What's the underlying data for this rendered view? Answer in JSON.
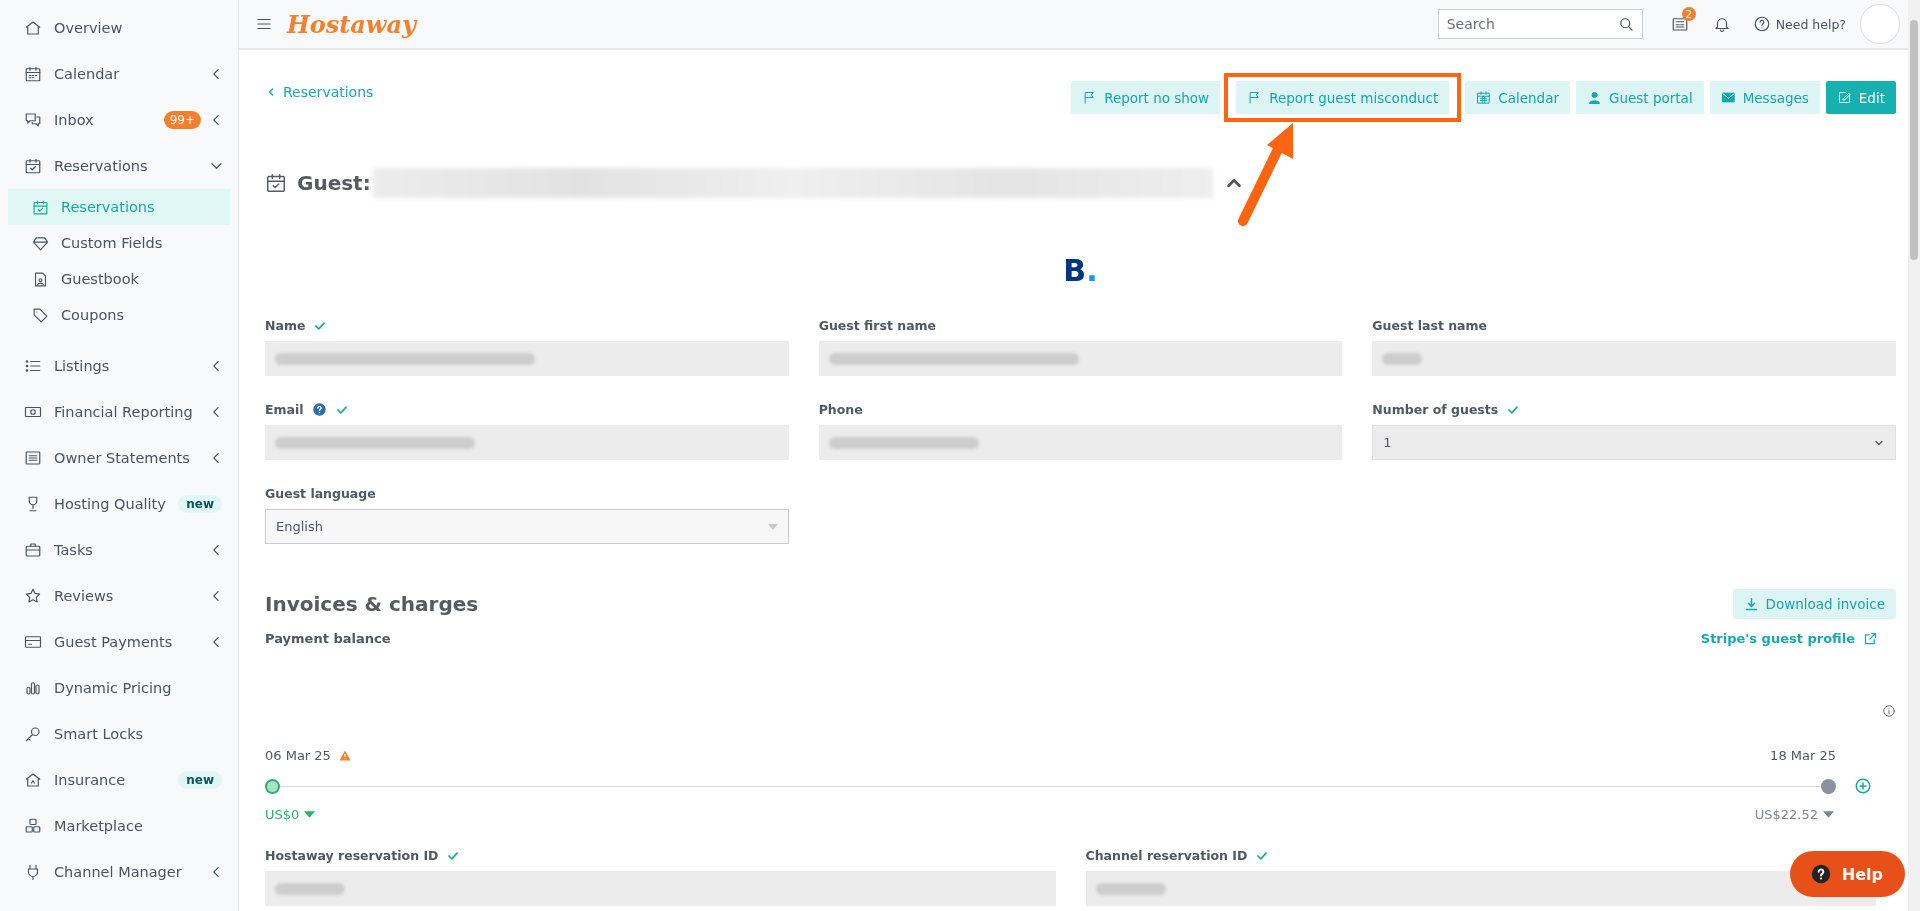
{
  "sidebar": {
    "items": [
      {
        "label": "Overview",
        "kind": "plain"
      },
      {
        "label": "Calendar",
        "kind": "collapsible",
        "expanded": false
      },
      {
        "label": "Inbox",
        "kind": "collapsible",
        "expanded": false,
        "badge": "99+"
      },
      {
        "label": "Reservations",
        "kind": "collapsible",
        "expanded": true,
        "children": [
          {
            "label": "Reservations",
            "selected": true
          },
          {
            "label": "Custom Fields",
            "selected": false
          },
          {
            "label": "Guestbook",
            "selected": false
          },
          {
            "label": "Coupons",
            "selected": false
          }
        ]
      },
      {
        "label": "Listings",
        "kind": "collapsible",
        "expanded": false
      },
      {
        "label": "Financial Reporting",
        "kind": "collapsible",
        "expanded": false
      },
      {
        "label": "Owner Statements",
        "kind": "collapsible",
        "expanded": false
      },
      {
        "label": "Hosting Quality",
        "kind": "tagged",
        "tag": "new"
      },
      {
        "label": "Tasks",
        "kind": "collapsible",
        "expanded": false
      },
      {
        "label": "Reviews",
        "kind": "collapsible",
        "expanded": false
      },
      {
        "label": "Guest Payments",
        "kind": "collapsible",
        "expanded": false
      },
      {
        "label": "Dynamic Pricing",
        "kind": "plain"
      },
      {
        "label": "Smart Locks",
        "kind": "plain"
      },
      {
        "label": "Insurance",
        "kind": "tagged",
        "tag": "new"
      },
      {
        "label": "Marketplace",
        "kind": "plain"
      },
      {
        "label": "Channel Manager",
        "kind": "collapsible",
        "expanded": false
      }
    ]
  },
  "topbar": {
    "logo": "Hostaway",
    "search": {
      "placeholder": "Search"
    },
    "notification_count": "2",
    "help": "Need help?"
  },
  "back_link": "Reservations",
  "actions": [
    {
      "label": "Report no show",
      "kind": "secondary",
      "highlighted": false
    },
    {
      "label": "Report guest misconduct",
      "kind": "secondary",
      "highlighted": true
    },
    {
      "label": "Calendar",
      "kind": "secondary",
      "highlighted": false
    },
    {
      "label": "Guest portal",
      "kind": "secondary",
      "highlighted": false
    },
    {
      "label": "Messages",
      "kind": "secondary",
      "highlighted": false
    },
    {
      "label": "Edit",
      "kind": "primary",
      "highlighted": false
    }
  ],
  "guest": {
    "title": "Guest:",
    "expanded": true,
    "channel_logo": "B."
  },
  "fields": [
    {
      "label": "Name",
      "verified": true,
      "help": false,
      "kind": "blurred"
    },
    {
      "label": "Guest first name",
      "verified": false,
      "help": false,
      "kind": "blurred"
    },
    {
      "label": "Guest last name",
      "verified": false,
      "help": false,
      "kind": "blurred"
    },
    {
      "label": "Email",
      "verified": true,
      "help": true,
      "kind": "blurred"
    },
    {
      "label": "Phone",
      "verified": false,
      "help": false,
      "kind": "blurred"
    },
    {
      "label": "Number of guests",
      "verified": true,
      "help": false,
      "kind": "select",
      "value": "1"
    },
    {
      "label": "Guest language",
      "verified": false,
      "help": false,
      "kind": "dropdown",
      "value": "English"
    }
  ],
  "invoices": {
    "title": "Invoices & charges",
    "download": "Download invoice",
    "payment_balance": "Payment balance",
    "stripe_link": "Stripe's guest profile",
    "timeline": [
      {
        "date": "06 Mar 25",
        "warning": true,
        "amount": "US$0",
        "paid": true
      },
      {
        "date": "18 Mar 25",
        "warning": false,
        "amount": "US$22.52",
        "paid": false
      }
    ]
  },
  "ids": [
    {
      "label": "Hostaway reservation ID",
      "verified": true
    },
    {
      "label": "Channel reservation ID",
      "verified": true
    }
  ],
  "help_button": "Help"
}
